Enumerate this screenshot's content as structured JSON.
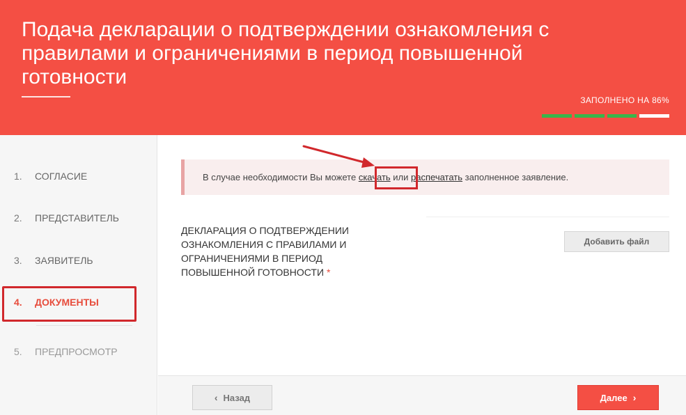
{
  "header": {
    "title": "Подача декларации о подтверждении ознакомления с правилами и ограничениями в период повышенной готовности",
    "progress_label": "ЗАПОЛНЕНО НА 86%",
    "progress_percent": 86,
    "progress_segments_filled": 3,
    "progress_segments_total": 4
  },
  "sidebar": {
    "items": [
      {
        "num": "1.",
        "label": "СОГЛАСИЕ"
      },
      {
        "num": "2.",
        "label": "ПРЕДСТАВИТЕЛЬ"
      },
      {
        "num": "3.",
        "label": "ЗАЯВИТЕЛЬ"
      },
      {
        "num": "4.",
        "label": "ДОКУМЕНТЫ"
      },
      {
        "num": "5.",
        "label": "ПРЕДПРОСМОТР"
      }
    ]
  },
  "alert": {
    "text_before": "В случае необходимости Вы можете ",
    "download_link": "скачать",
    "text_middle": " или ",
    "print_link": "распечатать",
    "text_after": " заполненное заявление."
  },
  "document": {
    "label": "ДЕКЛАРАЦИЯ О ПОДТВЕРЖДЕНИИ ОЗНАКОМЛЕНИЯ С ПРАВИЛАМИ И ОГРАНИЧЕНИЯМИ В ПЕРИОД ПОВЫШЕННОЙ ГОТОВНОСТИ",
    "required_mark": "*",
    "add_file_label": "Добавить файл"
  },
  "footer": {
    "back_label": "Назад",
    "next_label": "Далее",
    "back_icon": "‹",
    "next_icon": "›"
  },
  "colors": {
    "brand": "#f44f44",
    "progress_fill": "#3ab54a",
    "annotation": "#d1282c"
  }
}
